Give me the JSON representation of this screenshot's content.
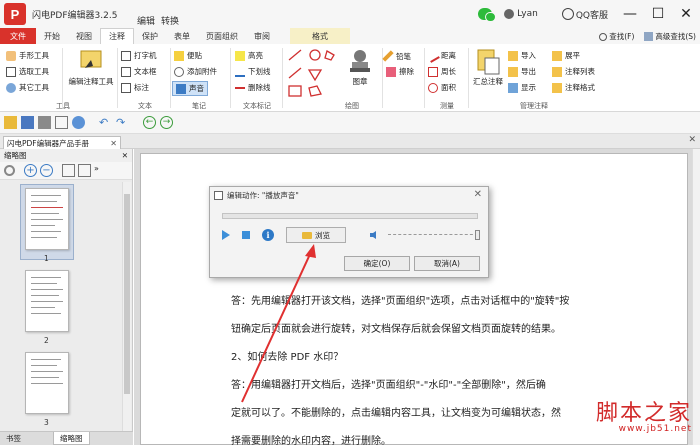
{
  "app": {
    "logo_letter": "P",
    "title": "闪电PDF编辑器3.2.5",
    "menus": [
      "编辑",
      "转换"
    ],
    "user": "Lyan",
    "qq_service": "QQ客服"
  },
  "tabs": {
    "file": "文件",
    "items": [
      "开始",
      "视图",
      "注释",
      "保护",
      "表单",
      "页面组织",
      "审阅"
    ],
    "active": "注释",
    "format": "格式",
    "find": "查找(F)",
    "advanced_find": "高级查找(S)"
  },
  "ribbon": {
    "tools": {
      "hand": "手形工具",
      "select_text": "选取工具",
      "other": "其它工具",
      "label": "工具"
    },
    "edit_annot": "编辑注释工具",
    "text_group": {
      "typewriter": "打字机",
      "textbox": "文本框",
      "callout": "标注",
      "label": "文本"
    },
    "note_group": {
      "sticky": "便贴",
      "attach": "添加附件",
      "sound": "声音",
      "label": "笔记"
    },
    "markup_group": {
      "highlight": "高亮",
      "underline": "下划线",
      "strikeout": "删除线",
      "label": "文本标记"
    },
    "drawing": {
      "label": "绘图"
    },
    "stamp": "图章",
    "pencil_group": {
      "pencil": "铅笔",
      "eraser": "擦除"
    },
    "measure_group": {
      "distance": "距离",
      "perimeter": "周长",
      "area": "面积",
      "label": "测量"
    },
    "manage_group": {
      "summary": "汇总注释",
      "import": "导入",
      "export": "导出",
      "show": "显示",
      "flatten": "展平",
      "list": "注释列表",
      "format": "注释格式",
      "label": "管理注释"
    }
  },
  "document": {
    "tab_title": "闪电PDF编辑器产品手册",
    "paragraphs": [
      "答：先用编辑器打开该文档，选择\"页面组织\"选项，点击对话框中的\"旋转\"按",
      "钮确定后页面就会进行旋转，对文档保存后就会保留文档页面旋转的结果。",
      "2、如何去除 PDF 水印？",
      "答：用编辑器打开文档后，选择\"页面组织\"-\"水印\"-\"全部删除\"，然后确",
      "定就可以了。不能删除的，点击编辑内容工具，让文档变为可编辑状态，然",
      "择需要删除的水印内容，进行删除。"
    ]
  },
  "leftpanel": {
    "title": "缩略图",
    "thumbnails": [
      "1",
      "2",
      "3"
    ],
    "bottom_tabs": [
      "书签",
      "缩略图"
    ],
    "active_bottom": "缩略图"
  },
  "dialog": {
    "title": "编辑动作: \"播放声音\"",
    "browse": "浏览",
    "ok": "确定(O)",
    "cancel": "取消(A)"
  },
  "watermark": {
    "text": "脚本之家",
    "url": "www.jb51.net"
  },
  "colors": {
    "brand_red": "#d9322b",
    "format_tab": "#f7f0c7",
    "arrow": "#e03030"
  }
}
